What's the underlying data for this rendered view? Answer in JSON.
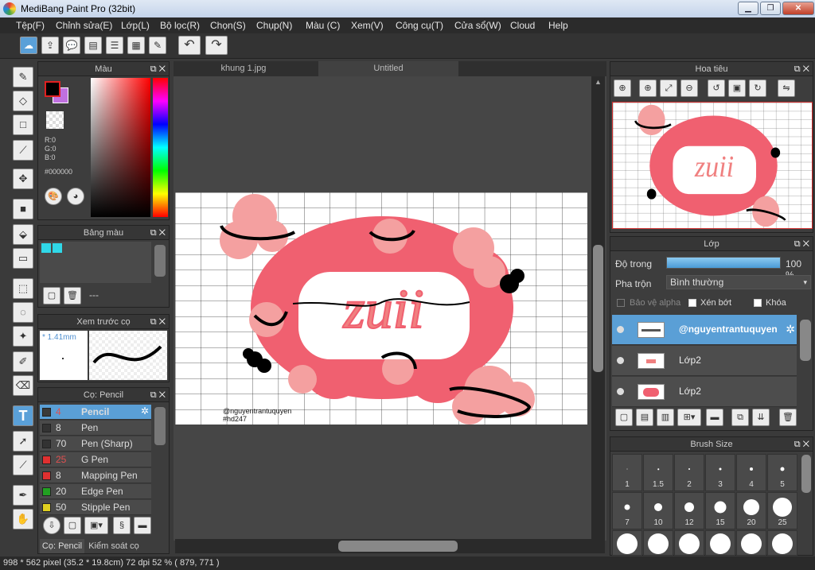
{
  "window": {
    "title": "MediBang Paint Pro (32bit)",
    "minimize": "▁",
    "maximize": "❐",
    "close": "✕"
  },
  "menu": [
    "Tệp(F)",
    "Chỉnh sửa(E)",
    "Lớp(L)",
    "Bộ lọc(R)",
    "Chọn(S)",
    "Chụp(N)",
    "Màu (C)",
    "Xem(V)",
    "Công cụ(T)",
    "Cửa sổ(W)",
    "Cloud",
    "Help"
  ],
  "tabs": [
    "khung 1.jpg",
    "Untitled"
  ],
  "color_panel": {
    "title": "Màu",
    "r": "R:0",
    "g": "G:0",
    "b": "B:0",
    "hex": "#000000"
  },
  "palette_panel": {
    "title": "Bảng màu",
    "status": "---"
  },
  "preview_panel": {
    "title": "Xem trước cọ",
    "size": "* 1.41mm"
  },
  "brush_panel": {
    "title": "Cọ: Pencil",
    "brushes": [
      {
        "size": "4",
        "name": "Pencil",
        "color": "#3a3a3a"
      },
      {
        "size": "8",
        "name": "Pen",
        "color": "#333333"
      },
      {
        "size": "70",
        "name": "Pen (Sharp)",
        "color": "#333333"
      },
      {
        "size": "25",
        "name": "G Pen",
        "color": "#e03030"
      },
      {
        "size": "8",
        "name": "Mapping Pen",
        "color": "#e03030"
      },
      {
        "size": "20",
        "name": "Edge Pen",
        "color": "#22a022"
      },
      {
        "size": "50",
        "name": "Stipple Pen",
        "color": "#e0d020"
      }
    ],
    "bottom_tabs": [
      "Cọ: Pencil",
      "Kiểm soát cọ"
    ]
  },
  "navigator": {
    "title": "Hoa tiêu"
  },
  "layer_panel": {
    "title": "Lớp",
    "opacity_label": "Độ trong",
    "opacity_value": "100 %",
    "opacity": 1.0,
    "blend_label": "Pha trộn",
    "blend_value": "Bình thường",
    "protect_alpha": "Bảo vệ alpha",
    "clip": "Xén bớt",
    "lock": "Khóa",
    "layers": [
      {
        "name": "@nguyentrantuquyen"
      },
      {
        "name": "Lớp2"
      },
      {
        "name": "Lớp2"
      }
    ]
  },
  "brush_size": {
    "title": "Brush Size",
    "row1": [
      "1",
      "1.5",
      "2",
      "3",
      "4",
      "5"
    ],
    "row2": [
      "7",
      "10",
      "12",
      "15",
      "20",
      "25"
    ]
  },
  "artwork": {
    "watermark": "@nguyentrantuquyen",
    "tag": "#hd247"
  },
  "status": "998 * 562 pixel   (35.2 * 19.8cm)   72 dpi   52 %   ( 879, 771 )",
  "colors": {
    "accent": "#5aa0d8",
    "art_pink": "#f06070",
    "art_light": "#f4a0a0"
  }
}
